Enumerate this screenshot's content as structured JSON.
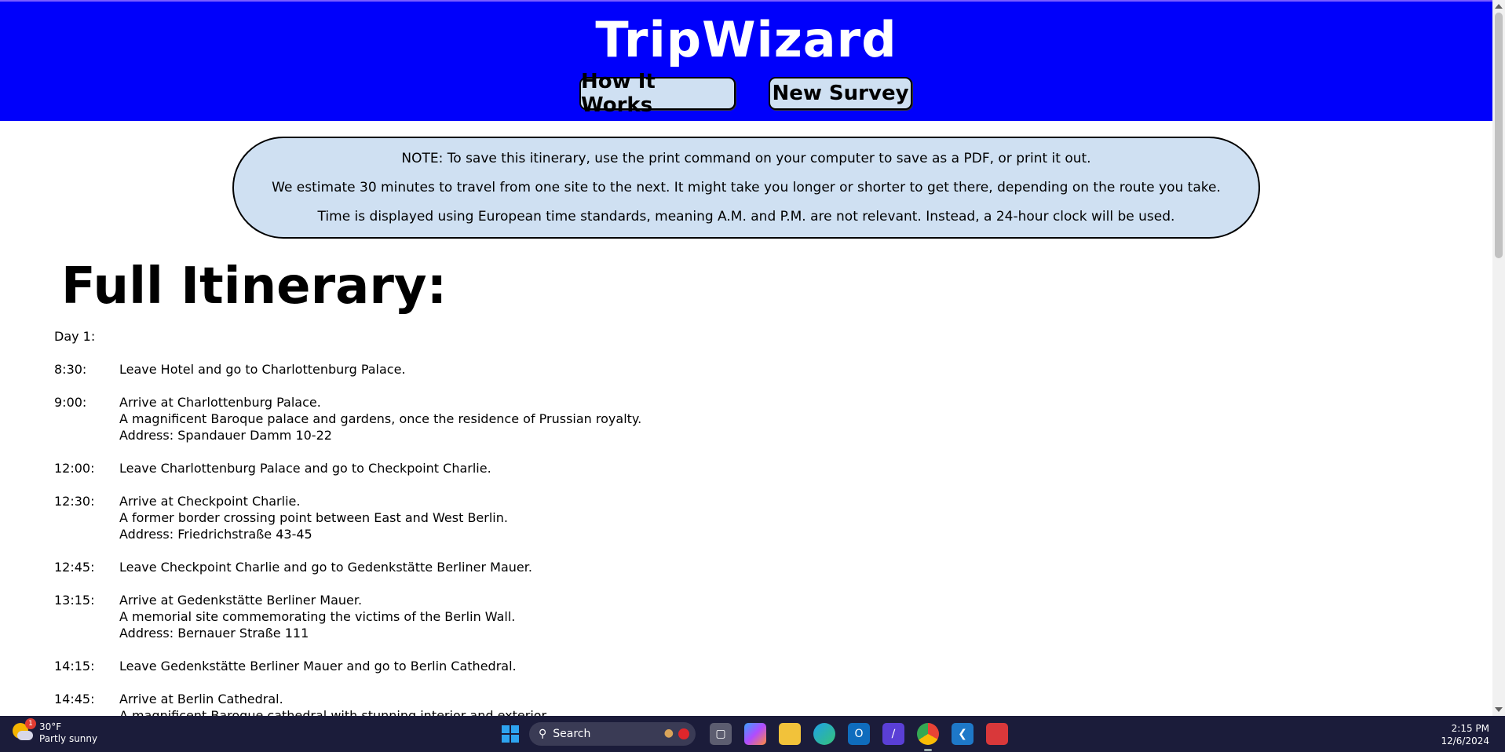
{
  "header": {
    "brand": "TripWizard",
    "nav": {
      "how_it_works": "How It Works",
      "new_survey": "New Survey"
    }
  },
  "note": {
    "lines": [
      "NOTE: To save this itinerary, use the print command on your computer to save as a PDF, or print it out.",
      "We estimate 30 minutes to travel from one site to the next. It might take you longer or shorter to get there, depending on the route you take.",
      "Time is displayed using European time standards, meaning A.M. and P.M. are not relevant. Instead, a 24-hour clock will be used."
    ]
  },
  "itinerary": {
    "title": "Full Itinerary:",
    "day_label": "Day 1:",
    "entries": [
      {
        "time": "8:30:",
        "lines": [
          "Leave Hotel and go to Charlottenburg Palace."
        ]
      },
      {
        "time": "9:00:",
        "lines": [
          "Arrive at Charlottenburg Palace.",
          "A magnificent Baroque palace and gardens, once the residence of Prussian royalty.",
          "Address: Spandauer Damm 10-22"
        ]
      },
      {
        "time": "12:00:",
        "lines": [
          "Leave Charlottenburg Palace and go to Checkpoint Charlie."
        ]
      },
      {
        "time": "12:30:",
        "lines": [
          "Arrive at Checkpoint Charlie.",
          "A former border crossing point between East and West Berlin.",
          "Address: Friedrichstraße 43-45"
        ]
      },
      {
        "time": "12:45:",
        "lines": [
          "Leave Checkpoint Charlie and go to Gedenkstätte Berliner Mauer."
        ]
      },
      {
        "time": "13:15:",
        "lines": [
          "Arrive at Gedenkstätte Berliner Mauer.",
          "A memorial site commemorating the victims of the Berlin Wall.",
          "Address: Bernauer Straße 111"
        ]
      },
      {
        "time": "14:15:",
        "lines": [
          "Leave Gedenkstätte Berliner Mauer and go to Berlin Cathedral."
        ]
      },
      {
        "time": "14:45:",
        "lines": [
          "Arrive at Berlin Cathedral.",
          "A magnificent Baroque cathedral with stunning interior and exterior."
        ]
      }
    ]
  },
  "taskbar": {
    "weather": {
      "temp": "30°F",
      "condition": "Partly sunny",
      "badge": "1",
      "icon": "partly-sunny-icon"
    },
    "search_label": "Search",
    "apps": [
      "windows-start-icon",
      "task-view-icon",
      "copilot-icon",
      "file-explorer-icon",
      "edge-icon",
      "outlook-icon",
      "visual-studio-icon",
      "chrome-icon",
      "vscode-icon",
      "snipping-tool-icon"
    ],
    "clock": {
      "time": "2:15 PM",
      "date": "12/6/2024"
    }
  },
  "colors": {
    "header_bg": "#0000fb",
    "panel_bg": "#cfe0f2",
    "taskbar_bg": "#1b1c3a"
  }
}
